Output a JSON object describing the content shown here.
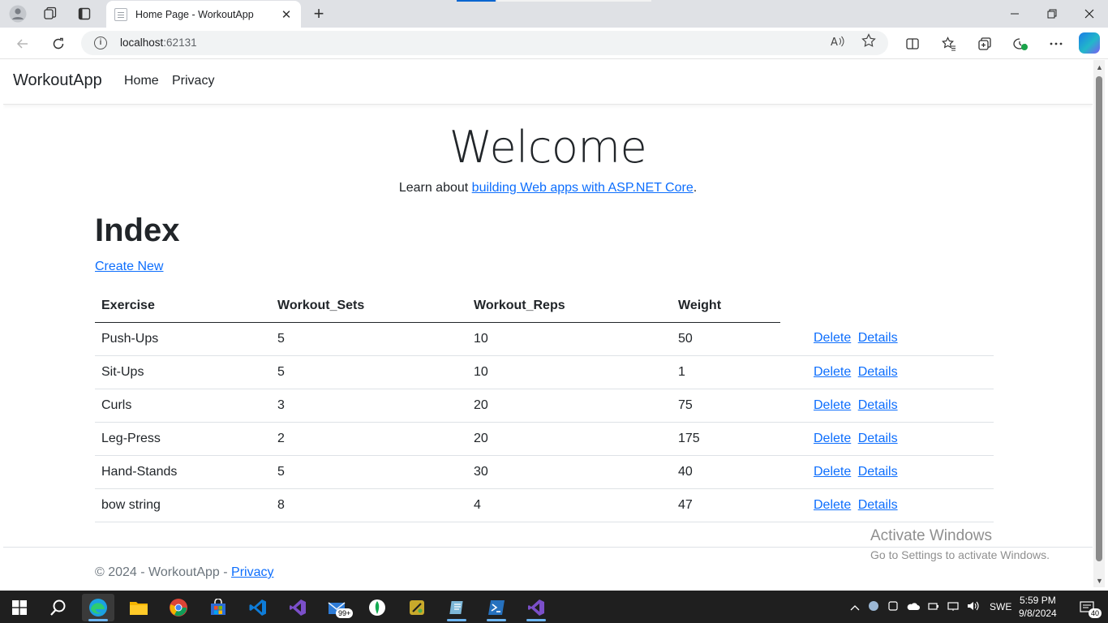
{
  "browser": {
    "tab_title": "Home Page - WorkoutApp",
    "tab_close": "✕",
    "new_tab": "+",
    "url_host": "localhost",
    "url_port": ":62131"
  },
  "nav": {
    "brand": "WorkoutApp",
    "links": [
      "Home",
      "Privacy"
    ]
  },
  "main": {
    "welcome": "Welcome",
    "learn_prefix": "Learn about ",
    "learn_link": "building Web apps with ASP.NET Core",
    "learn_suffix": ".",
    "heading": "Index",
    "create_new": "Create New"
  },
  "table": {
    "columns": [
      "Exercise",
      "Workout_Sets",
      "Workout_Reps",
      "Weight"
    ],
    "rows": [
      {
        "exercise": "Push-Ups",
        "sets": "5",
        "reps": "10",
        "weight": "50"
      },
      {
        "exercise": "Sit-Ups",
        "sets": "5",
        "reps": "10",
        "weight": "1"
      },
      {
        "exercise": "Curls",
        "sets": "3",
        "reps": "20",
        "weight": "75"
      },
      {
        "exercise": "Leg-Press",
        "sets": "2",
        "reps": "20",
        "weight": "175"
      },
      {
        "exercise": "Hand-Stands",
        "sets": "5",
        "reps": "30",
        "weight": "40"
      },
      {
        "exercise": "bow string",
        "sets": "8",
        "reps": "4",
        "weight": "47"
      }
    ],
    "delete_label": "Delete",
    "details_label": "Details"
  },
  "footer": {
    "text": "© 2024 - WorkoutApp - ",
    "privacy": "Privacy"
  },
  "watermark": {
    "line1": "Activate Windows",
    "line2": "Go to Settings to activate Windows."
  },
  "taskbar": {
    "mail_badge": "99+",
    "language": "SWE",
    "time": "5:59 PM",
    "date": "9/8/2024",
    "notification_count": "40"
  },
  "colors": {
    "link": "#0d6efd",
    "taskbar": "#1f1f1f",
    "tabstrip": "#dfe1e5"
  }
}
